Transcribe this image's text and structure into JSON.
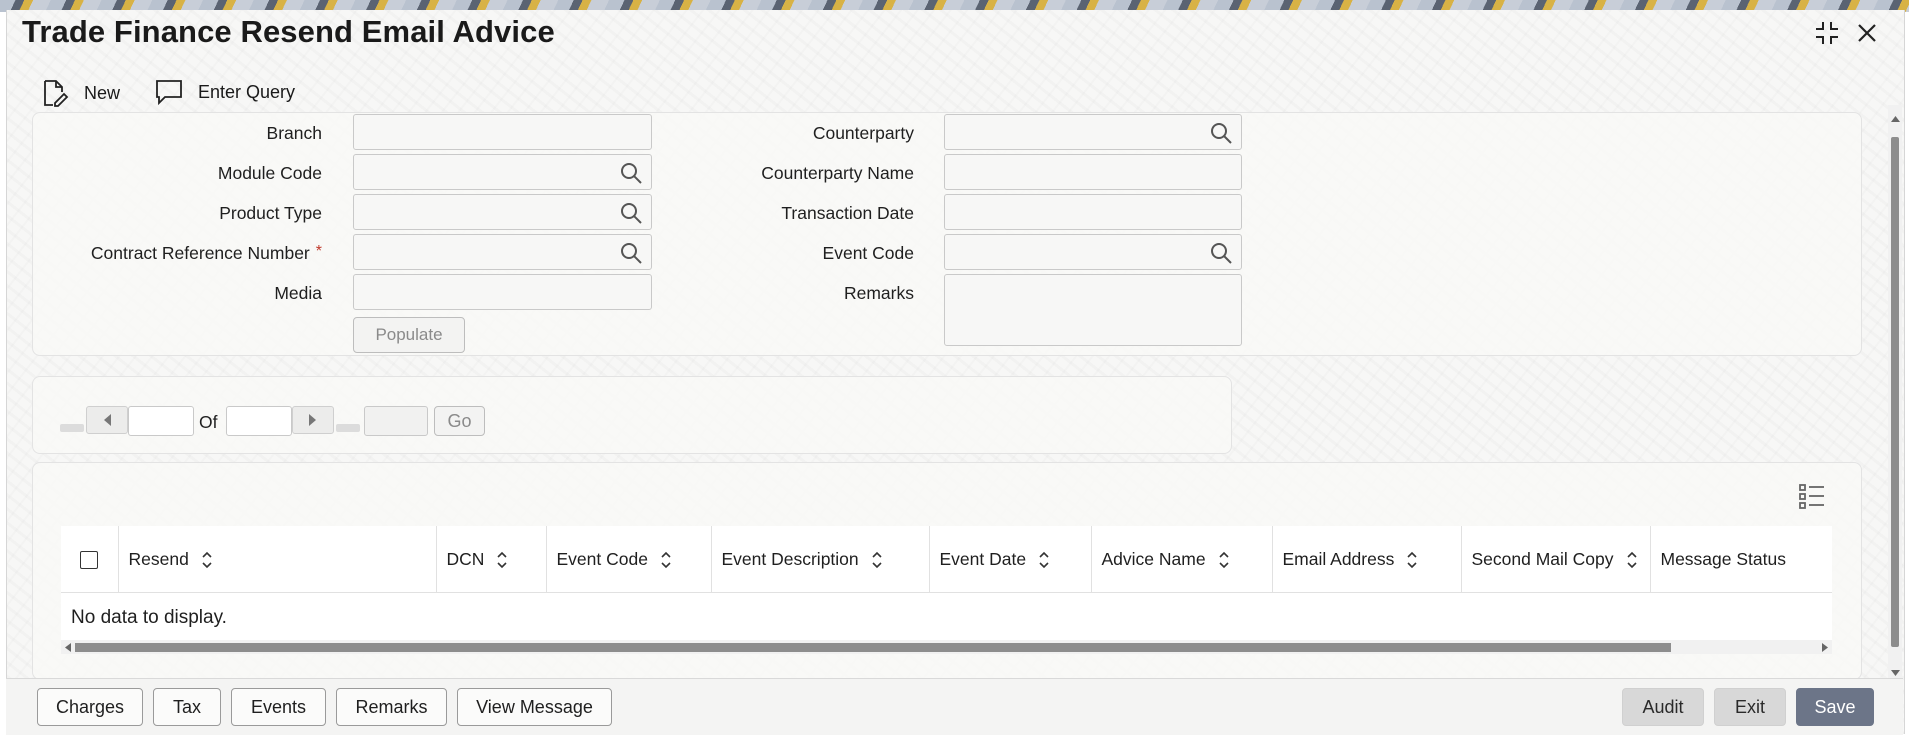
{
  "window": {
    "title": "Trade Finance Resend Email Advice"
  },
  "toolbar": {
    "new_label": "New",
    "enter_query_label": "Enter Query"
  },
  "form": {
    "branch_label": "Branch",
    "module_code_label": "Module Code",
    "product_type_label": "Product Type",
    "contract_ref_label": "Contract Reference Number",
    "required_mark": "*",
    "media_label": "Media",
    "populate_label": "Populate",
    "counterparty_label": "Counterparty",
    "counterparty_name_label": "Counterparty Name",
    "transaction_date_label": "Transaction Date",
    "event_code_label": "Event Code",
    "remarks_label": "Remarks"
  },
  "pagination": {
    "of_label": "Of",
    "go_label": "Go"
  },
  "table": {
    "columns": [
      "Resend",
      "DCN",
      "Event Code",
      "Event Description",
      "Event Date",
      "Advice Name",
      "Email Address",
      "Second Mail Copy",
      "Message Status"
    ],
    "empty_message": "No data to display."
  },
  "footer": {
    "left_buttons": [
      "Charges",
      "Tax",
      "Events",
      "Remarks",
      "View Message"
    ],
    "audit_label": "Audit",
    "exit_label": "Exit",
    "save_label": "Save"
  },
  "colors": {
    "save_bg": "#6c7588",
    "required": "#c0392b"
  }
}
